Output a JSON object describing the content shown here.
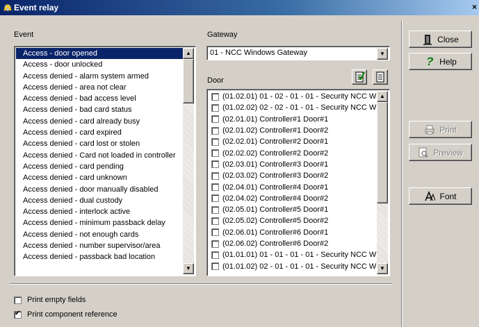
{
  "window": {
    "title": "Event relay",
    "close_glyph": "×"
  },
  "event": {
    "label": "Event",
    "items": [
      "Access - door opened",
      "Access - door unlocked",
      "Access denied - alarm system armed",
      "Access denied - area not clear",
      "Access denied - bad access level",
      "Access denied - bad card status",
      "Access denied - card already busy",
      "Access denied - card expired",
      "Access denied - card lost or stolen",
      "Access denied - Card not loaded in controller",
      "Access denied - card pending",
      "Access denied - card unknown",
      "Access denied - door manually disabled",
      "Access denied - dual custody",
      "Access denied - interlock active",
      "Access denied - minimum passback delay",
      "Access denied - not enough cards",
      "Access denied - number supervisor/area",
      "Access denied - passback bad location"
    ],
    "selected_index": 0
  },
  "gateway": {
    "label": "Gateway",
    "value": "01 - NCC Windows Gateway"
  },
  "door": {
    "label": "Door",
    "items": [
      "(01.02.01) 01 - 02 - 01 - 01 - Security NCC W",
      "(01.02.02) 02 - 02 - 01 - 01 - Security NCC W",
      "(02.01.01) Controller#1 Door#1",
      "(02.01.02) Controller#1 Door#2",
      "(02.02.01) Controller#2 Door#1",
      "(02.02.02) Controller#2 Door#2",
      "(02.03.01) Controller#3 Door#1",
      "(02.03.02) Controller#3 Door#2",
      "(02.04.01) Controller#4 Door#1",
      "(02.04.02) Controller#4 Door#2",
      "(02.05.01) Controller#5 Door#1",
      "(02.05.02) Controller#5 Door#2",
      "(02.06.01) Controller#6 Door#1",
      "(02.06.02) Controller#6 Door#2",
      "(01.01.01) 01 - 01 - 01 - 01 - Security NCC W",
      "(01.01.02) 02 - 01 - 01 - 01 - Security NCC W"
    ]
  },
  "buttons": {
    "close": "Close",
    "help": "Help",
    "print": "Print",
    "preview": "Preview",
    "font": "Font"
  },
  "options": {
    "print_empty_fields": {
      "label": "Print empty fields",
      "checked": false
    },
    "print_component_reference": {
      "label": "Print component reference",
      "checked": true
    }
  },
  "icons": {
    "window": "event-relay-icon",
    "check_all": "check-all-icon",
    "uncheck_all": "uncheck-all-icon",
    "close": "door-exit-icon",
    "help": "question-icon",
    "print": "printer-icon",
    "preview": "preview-icon",
    "font": "font-icon"
  }
}
